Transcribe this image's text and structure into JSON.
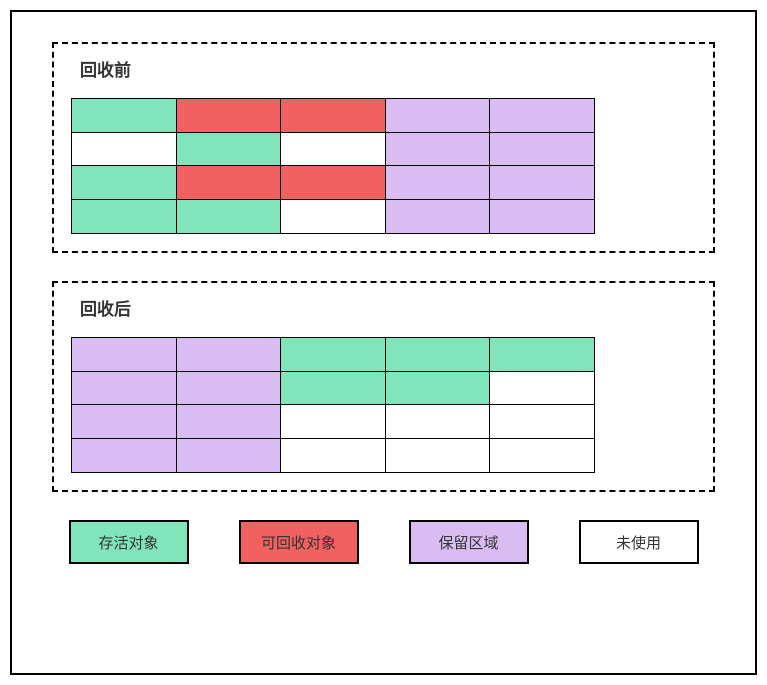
{
  "sections": {
    "before": {
      "title": "回收前",
      "grid": [
        [
          "alive",
          "recyclable",
          "recyclable",
          "reserved",
          "reserved"
        ],
        [
          "unused",
          "alive",
          "unused",
          "reserved",
          "reserved"
        ],
        [
          "alive",
          "recyclable",
          "recyclable",
          "reserved",
          "reserved"
        ],
        [
          "alive",
          "alive",
          "unused",
          "reserved",
          "reserved"
        ]
      ]
    },
    "after": {
      "title": "回收后",
      "grid": [
        [
          "reserved",
          "reserved",
          "alive",
          "alive",
          "alive"
        ],
        [
          "reserved",
          "reserved",
          "alive",
          "alive",
          "unused"
        ],
        [
          "reserved",
          "reserved",
          "unused",
          "unused",
          "unused"
        ],
        [
          "reserved",
          "reserved",
          "unused",
          "unused",
          "unused"
        ]
      ]
    }
  },
  "legend": {
    "alive": "存活对象",
    "recyclable": "可回收对象",
    "reserved": "保留区域",
    "unused": "未使用"
  },
  "colors": {
    "alive": "#80e5ba",
    "recyclable": "#f0615f",
    "reserved": "#d9bdf2",
    "unused": "#ffffff"
  }
}
